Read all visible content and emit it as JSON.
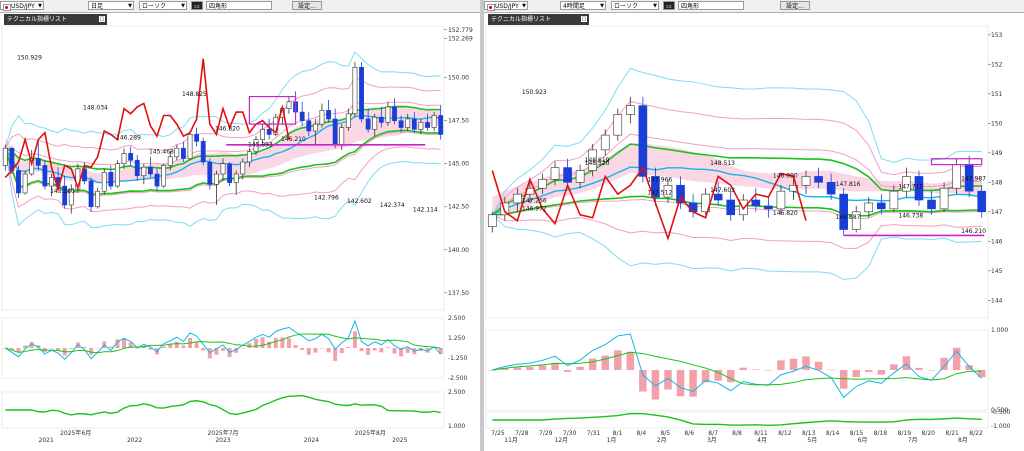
{
  "left": {
    "toolbar": {
      "symbol": "USD/JPY",
      "timeframe": "日足",
      "chart_style": "ローソク",
      "drawing_tool": "四角形",
      "settings_label": "設定..."
    },
    "indicator_legend": "テクニカル指標リスト"
  },
  "right": {
    "toolbar": {
      "symbol": "USD/JPY",
      "timeframe": "4時間足",
      "chart_style": "ローソク",
      "drawing_tool": "四角形",
      "settings_label": "設定..."
    },
    "indicator_legend": "テクニカル指標リスト"
  },
  "colors": {
    "bull_candle": "#ffffff",
    "bear_candle": "#1a3fd6",
    "bollinger_outer": "#7fdcf5",
    "bollinger_inner": "#f29ec4",
    "ma_green": "#1cc21c",
    "ma_cyan": "#14b6e6",
    "chikou_red": "#e01010",
    "cloud_pink": "#f7b6d2",
    "cloud_blue": "#a8d2f2",
    "rect_magenta": "#cc22cc",
    "macd_hist": "#f4a0a8"
  },
  "chart_data": [
    {
      "type": "candlestick",
      "pane": "left",
      "price_axis": [
        "152.779",
        "152.269",
        "150.00",
        "147.50",
        "145.00",
        "142.50",
        "140.00",
        "137.50",
        "2.500",
        "1.250",
        "-1.250",
        "-2.500",
        "2.500",
        "1.000"
      ],
      "time_axis_top": [
        "2025年6月",
        "2025年7月",
        "2025年8月"
      ],
      "time_axis_bottom": [
        "2021",
        "2022",
        "2023",
        "2024",
        "2025"
      ],
      "price_labels": [
        "150.929",
        "143.180",
        "148.034",
        "146.289",
        "145.468",
        "148.825",
        "146.820",
        "145.893",
        "146.210",
        "142.796",
        "142.602",
        "142.374",
        "142.114"
      ],
      "ylim": [
        136.5,
        153.0
      ],
      "candles": [
        [
          144.9,
          146.1,
          144.6,
          145.9
        ],
        [
          145.9,
          146.0,
          144.4,
          144.6
        ],
        [
          144.6,
          144.9,
          143.0,
          143.3
        ],
        [
          143.3,
          144.6,
          143.2,
          144.4
        ],
        [
          144.4,
          145.8,
          144.3,
          145.3
        ],
        [
          145.3,
          146.3,
          144.6,
          144.9
        ],
        [
          144.9,
          145.2,
          143.5,
          143.7
        ],
        [
          143.7,
          144.4,
          143.1,
          144.2
        ],
        [
          144.2,
          144.8,
          143.5,
          143.7
        ],
        [
          143.7,
          144.3,
          142.4,
          142.6
        ],
        [
          142.6,
          143.8,
          142.1,
          143.5
        ],
        [
          143.5,
          145.0,
          143.3,
          144.7
        ],
        [
          144.7,
          145.1,
          143.8,
          144.0
        ],
        [
          144.0,
          144.2,
          142.2,
          142.5
        ],
        [
          142.5,
          143.6,
          142.4,
          143.4
        ],
        [
          143.4,
          144.7,
          143.2,
          144.5
        ],
        [
          144.5,
          144.9,
          143.5,
          143.7
        ],
        [
          143.7,
          145.2,
          143.6,
          145.0
        ],
        [
          145.0,
          145.9,
          144.7,
          145.6
        ],
        [
          145.6,
          146.0,
          144.9,
          145.2
        ],
        [
          145.2,
          145.5,
          144.0,
          144.3
        ],
        [
          144.3,
          145.0,
          143.8,
          144.8
        ],
        [
          144.8,
          145.4,
          144.2,
          144.4
        ],
        [
          144.4,
          144.7,
          143.4,
          143.7
        ],
        [
          143.7,
          145.0,
          143.6,
          144.9
        ],
        [
          144.9,
          145.7,
          144.6,
          145.4
        ],
        [
          145.4,
          146.1,
          145.2,
          145.9
        ],
        [
          145.9,
          146.3,
          145.1,
          145.3
        ],
        [
          145.3,
          146.9,
          145.2,
          146.7
        ],
        [
          146.7,
          147.1,
          146.0,
          146.3
        ],
        [
          146.3,
          146.5,
          144.9,
          145.1
        ],
        [
          145.1,
          145.3,
          143.5,
          143.8
        ],
        [
          143.8,
          144.6,
          142.6,
          144.4
        ],
        [
          144.4,
          145.3,
          144.0,
          145.0
        ],
        [
          145.0,
          145.1,
          143.7,
          143.9
        ],
        [
          143.9,
          144.6,
          143.2,
          144.4
        ],
        [
          144.4,
          145.3,
          144.1,
          145.1
        ],
        [
          145.1,
          145.9,
          144.8,
          145.7
        ],
        [
          145.7,
          146.6,
          145.5,
          146.4
        ],
        [
          146.4,
          147.3,
          146.2,
          147.0
        ],
        [
          147.0,
          147.6,
          146.4,
          146.7
        ],
        [
          146.7,
          147.9,
          146.6,
          147.7
        ],
        [
          147.7,
          148.4,
          147.3,
          148.2
        ],
        [
          148.2,
          148.9,
          147.9,
          148.6
        ],
        [
          148.6,
          149.2,
          147.8,
          148.0
        ],
        [
          148.0,
          148.6,
          147.2,
          147.5
        ],
        [
          147.5,
          148.0,
          146.6,
          146.9
        ],
        [
          146.9,
          147.6,
          146.1,
          147.3
        ],
        [
          147.3,
          148.5,
          147.1,
          148.1
        ],
        [
          148.1,
          148.7,
          147.4,
          147.6
        ],
        [
          147.6,
          148.2,
          145.9,
          146.1
        ],
        [
          146.1,
          147.3,
          145.8,
          147.1
        ],
        [
          147.1,
          148.2,
          146.9,
          147.9
        ],
        [
          147.9,
          150.9,
          147.7,
          150.6
        ],
        [
          150.6,
          150.9,
          147.4,
          147.6
        ],
        [
          147.6,
          148.2,
          146.8,
          147.0
        ],
        [
          147.0,
          147.9,
          146.6,
          147.7
        ],
        [
          147.7,
          148.3,
          147.1,
          147.4
        ],
        [
          147.4,
          148.6,
          147.2,
          148.3
        ],
        [
          148.3,
          148.8,
          147.3,
          147.5
        ],
        [
          147.5,
          147.8,
          146.8,
          147.1
        ],
        [
          147.1,
          147.9,
          146.9,
          147.6
        ],
        [
          147.6,
          148.0,
          146.8,
          147.0
        ],
        [
          147.0,
          147.6,
          146.7,
          147.4
        ],
        [
          147.4,
          147.9,
          146.9,
          147.1
        ],
        [
          147.1,
          148.0,
          146.9,
          147.8
        ],
        [
          147.8,
          148.4,
          146.4,
          146.7
        ]
      ]
    },
    {
      "type": "candlestick",
      "pane": "right",
      "price_axis": [
        "153",
        "152",
        "151",
        "150",
        "149",
        "148",
        "147",
        "146",
        "145",
        "144",
        "1.000",
        "0.500",
        "-0.500",
        "-1.000"
      ],
      "time_axis_top": [
        "7/25",
        "7/28",
        "7/29",
        "7/30",
        "7/31",
        "8/1",
        "8/4",
        "8/5",
        "8/6",
        "8/7",
        "8/8",
        "8/11",
        "8/12",
        "8/13",
        "8/14",
        "8/15",
        "8/18",
        "8/19",
        "8/20",
        "8/21",
        "8/22"
      ],
      "time_axis_bottom": [
        "11月",
        "12月",
        "1月",
        "2月",
        "3月",
        "4月",
        "5月",
        "6月",
        "7月",
        "8月"
      ],
      "price_labels": [
        "150.923",
        "148.619",
        "147.512",
        "147.603",
        "148.090",
        "147.816",
        "147.715",
        "147.987",
        "147.256",
        "148.520",
        "147.966",
        "148.513",
        "146.820",
        "146.687",
        "146.738",
        "146.210",
        "146.972"
      ],
      "ylim": [
        143.4,
        153.3
      ],
      "candles": [
        [
          146.5,
          147.0,
          146.3,
          146.9
        ],
        [
          146.9,
          147.5,
          146.7,
          147.3
        ],
        [
          147.3,
          147.8,
          147.0,
          147.6
        ],
        [
          147.6,
          148.0,
          147.3,
          147.8
        ],
        [
          147.8,
          148.3,
          147.6,
          148.1
        ],
        [
          148.1,
          148.7,
          147.9,
          148.5
        ],
        [
          148.5,
          148.8,
          147.8,
          148.0
        ],
        [
          148.0,
          148.6,
          147.8,
          148.4
        ],
        [
          148.4,
          149.3,
          148.2,
          149.1
        ],
        [
          149.1,
          149.8,
          148.9,
          149.6
        ],
        [
          149.6,
          150.5,
          149.4,
          150.3
        ],
        [
          150.3,
          150.9,
          150.0,
          150.6
        ],
        [
          150.6,
          150.9,
          148.0,
          148.2
        ],
        [
          148.2,
          148.5,
          147.2,
          147.5
        ],
        [
          147.5,
          148.1,
          147.3,
          147.9
        ],
        [
          147.9,
          148.2,
          147.1,
          147.3
        ],
        [
          147.3,
          147.6,
          146.8,
          147.0
        ],
        [
          147.0,
          147.8,
          146.9,
          147.6
        ],
        [
          147.6,
          148.0,
          147.2,
          147.4
        ],
        [
          147.4,
          147.7,
          146.7,
          146.9
        ],
        [
          146.9,
          147.6,
          146.7,
          147.4
        ],
        [
          147.4,
          147.8,
          147.0,
          147.2
        ],
        [
          147.2,
          147.5,
          146.8,
          147.1
        ],
        [
          147.1,
          147.9,
          146.9,
          147.7
        ],
        [
          147.7,
          148.2,
          147.4,
          147.9
        ],
        [
          147.9,
          148.4,
          147.6,
          148.2
        ],
        [
          148.2,
          148.5,
          147.8,
          148.0
        ],
        [
          148.0,
          148.3,
          147.4,
          147.6
        ],
        [
          147.6,
          147.8,
          146.2,
          146.4
        ],
        [
          146.4,
          147.2,
          146.3,
          147.0
        ],
        [
          147.0,
          147.5,
          146.8,
          147.3
        ],
        [
          147.3,
          147.6,
          146.9,
          147.1
        ],
        [
          147.1,
          147.9,
          147.0,
          147.7
        ],
        [
          147.7,
          148.5,
          147.5,
          148.2
        ],
        [
          148.2,
          148.4,
          147.2,
          147.4
        ],
        [
          147.4,
          147.7,
          146.9,
          147.1
        ],
        [
          147.1,
          148.0,
          147.0,
          147.8
        ],
        [
          147.8,
          148.8,
          147.6,
          148.6
        ],
        [
          148.6,
          148.9,
          147.5,
          147.7
        ],
        [
          147.7,
          147.9,
          146.8,
          147.0
        ]
      ]
    }
  ]
}
